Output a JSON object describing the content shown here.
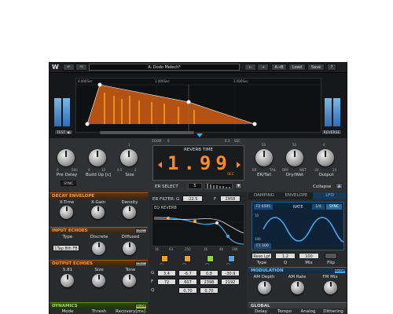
{
  "toolbar": {
    "undo": "↶",
    "redo": "↷",
    "preset_name": "A: Dodo Melech*",
    "prev": "←",
    "next": "→",
    "ab": "A→B",
    "load": "Load",
    "save": "Save",
    "help": "?"
  },
  "display": {
    "time_marks": [
      "0.000Sec",
      "1.000Sec",
      "2.000Sec"
    ],
    "test_button": "TEST ◀)",
    "reverse_button": "REVERSE",
    "zoom_label": "ZOOM",
    "zoom_min": "0",
    "zoom_max": "6.3",
    "zoom_unit": "SEC"
  },
  "main_controls": {
    "pre_delay": {
      "label": "Pre Delay",
      "ticks": [
        "0",
        "500"
      ]
    },
    "build_up": {
      "label": "Build Up [s]",
      "ticks": [
        "0",
        "10"
      ]
    },
    "size": {
      "label": "Size",
      "ticks": [
        "0.5",
        "2"
      ],
      "top_tick": "1"
    },
    "sync_button": "SYNC",
    "reverb_time": {
      "label": "REVERB TIME",
      "value": "1.99",
      "unit": "SEC"
    },
    "er_tail": {
      "label": "ER/Tail",
      "ticks": [
        "ER",
        "TAIL"
      ],
      "top_tick": "50"
    },
    "dry_wet": {
      "label": "Dry/Wet",
      "ticks": [
        "DRY",
        "WET"
      ],
      "top_tick": "50"
    },
    "output": {
      "label": "Output",
      "ticks": [
        "-24",
        "24"
      ],
      "top_tick": "0"
    }
  },
  "er_select": {
    "label": "ER SELECT",
    "value": "5",
    "collapse": "Collapse"
  },
  "left_panel": {
    "decay_envelope": {
      "title": "DECAY ENVELOPE",
      "knobs": [
        "X-Time",
        "X-Gain",
        "Density"
      ]
    },
    "input_echoes": {
      "title": "INPUT ECHOES",
      "onoff": "On/Off",
      "labels": [
        "Type",
        "Discrete",
        "Diffused"
      ],
      "type_value": "1Tap 8th FB"
    },
    "output_echoes": {
      "title": "OUTPUT ECHOES",
      "onoff": "On/Off",
      "labels": [
        "5.81",
        "Size",
        "Tone"
      ]
    },
    "dynamics": {
      "title": "DYNAMICS",
      "onoff": "On/Off",
      "labels": [
        "Mode",
        "Thresh",
        "Recovery[ms]"
      ]
    }
  },
  "eq_panel": {
    "er_filter_label": "ER FILTER:",
    "er_filter_g": "G",
    "er_filter_g_value": "-22.5",
    "er_filter_f": "F",
    "er_filter_f_value": "2958",
    "eq_title": "EQ REVERB",
    "freq_labels": [
      "16",
      "63",
      "250",
      "1K",
      "4K",
      "16K"
    ],
    "rows": {
      "G": [
        "3.4",
        "-6.7",
        "0.8",
        "-30.9"
      ],
      "F": [
        "72",
        "607",
        "2398",
        "2192"
      ],
      "Q": [
        "0.70",
        "0.70"
      ]
    },
    "row_labels": [
      "G",
      "F",
      "Q"
    ]
  },
  "mod_panel": {
    "tabs": [
      "DAMPING",
      "ENVELOPE",
      "LFO"
    ],
    "lfo_target": "F2 6595",
    "rate_label": "RATE",
    "rate_value": "1/4",
    "sync": "SYNC",
    "axis_top": "10",
    "axis_bottom": "100",
    "f1_label": "F1 100",
    "reso": "Reso Lpf",
    "q_value": "1.2",
    "mix_value": "100",
    "bottom_labels": [
      "Type",
      "Q",
      "Mix",
      "Flip"
    ],
    "modulation": {
      "title": "MODULATION",
      "onoff": "On/Off",
      "labels": [
        "AM Depth",
        "AM Rate",
        "FM Mix"
      ]
    },
    "global": {
      "title": "GLOBAL",
      "labels": [
        "Delay",
        "Tempo",
        "Analog",
        "Dithering"
      ]
    }
  },
  "colors": {
    "accent_orange": "#ff8a1e",
    "accent_blue": "#4aa8e8",
    "accent_green": "#8fd63e"
  }
}
